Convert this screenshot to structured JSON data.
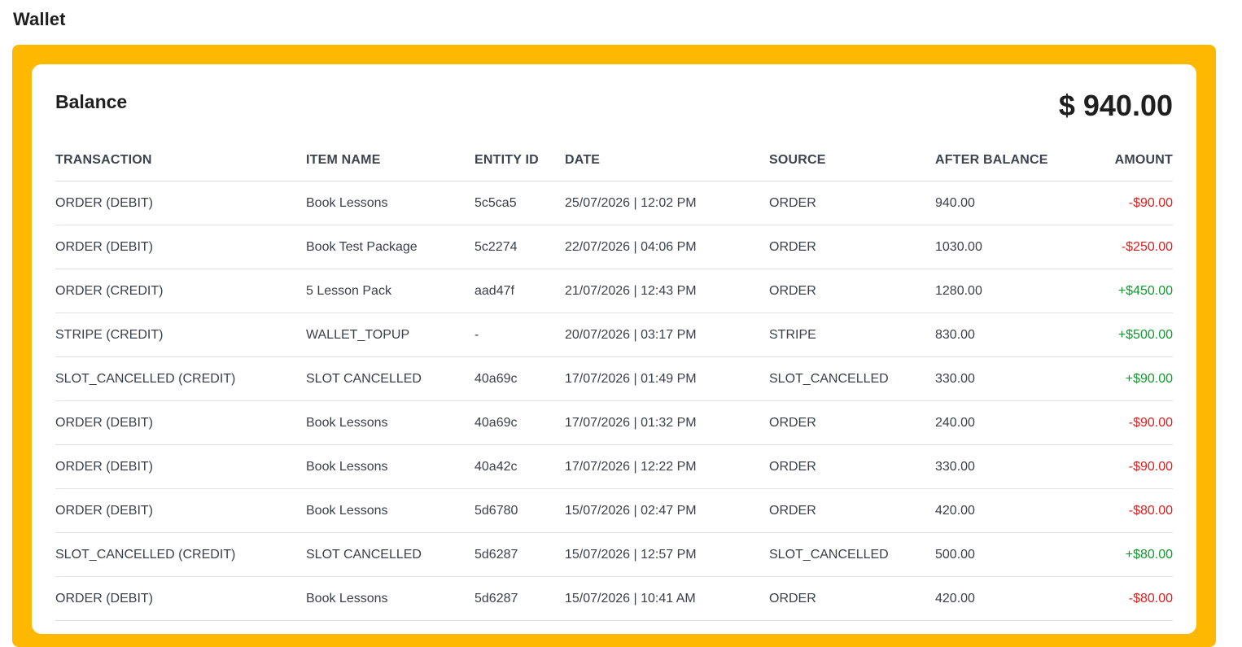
{
  "page": {
    "title": "Wallet"
  },
  "wallet": {
    "balance_label": "Balance",
    "balance_amount": "$ 940.00"
  },
  "colors": {
    "frame": "#ffb800",
    "debit": "#e01e1e",
    "credit": "#12992f"
  },
  "table": {
    "headers": [
      "TRANSACTION",
      "ITEM NAME",
      "ENTITY ID",
      "DATE",
      "SOURCE",
      "AFTER BALANCE",
      "AMOUNT"
    ],
    "rows": [
      {
        "transaction": "ORDER (DEBIT)",
        "item_name": "Book Lessons",
        "entity_id": "5c5ca5",
        "date": "25/07/2026 | 12:02 PM",
        "source": "ORDER",
        "after_balance": "940.00",
        "amount": "-$90.00",
        "type": "debit"
      },
      {
        "transaction": "ORDER (DEBIT)",
        "item_name": "Book Test Package",
        "entity_id": "5c2274",
        "date": "22/07/2026 | 04:06 PM",
        "source": "ORDER",
        "after_balance": "1030.00",
        "amount": "-$250.00",
        "type": "debit"
      },
      {
        "transaction": "ORDER (CREDIT)",
        "item_name": "5 Lesson Pack",
        "entity_id": "aad47f",
        "date": "21/07/2026 | 12:43 PM",
        "source": "ORDER",
        "after_balance": "1280.00",
        "amount": "+$450.00",
        "type": "credit"
      },
      {
        "transaction": "STRIPE (CREDIT)",
        "item_name": "WALLET_TOPUP",
        "entity_id": "-",
        "date": "20/07/2026 | 03:17 PM",
        "source": "STRIPE",
        "after_balance": "830.00",
        "amount": "+$500.00",
        "type": "credit"
      },
      {
        "transaction": "SLOT_CANCELLED (CREDIT)",
        "item_name": "SLOT CANCELLED",
        "entity_id": "40a69c",
        "date": "17/07/2026 | 01:49 PM",
        "source": "SLOT_CANCELLED",
        "after_balance": "330.00",
        "amount": "+$90.00",
        "type": "credit"
      },
      {
        "transaction": "ORDER (DEBIT)",
        "item_name": "Book Lessons",
        "entity_id": "40a69c",
        "date": "17/07/2026 | 01:32 PM",
        "source": "ORDER",
        "after_balance": "240.00",
        "amount": "-$90.00",
        "type": "debit"
      },
      {
        "transaction": "ORDER (DEBIT)",
        "item_name": "Book Lessons",
        "entity_id": "40a42c",
        "date": "17/07/2026 | 12:22 PM",
        "source": "ORDER",
        "after_balance": "330.00",
        "amount": "-$90.00",
        "type": "debit"
      },
      {
        "transaction": "ORDER (DEBIT)",
        "item_name": "Book Lessons",
        "entity_id": "5d6780",
        "date": "15/07/2026 | 02:47 PM",
        "source": "ORDER",
        "after_balance": "420.00",
        "amount": "-$80.00",
        "type": "debit"
      },
      {
        "transaction": "SLOT_CANCELLED (CREDIT)",
        "item_name": "SLOT CANCELLED",
        "entity_id": "5d6287",
        "date": "15/07/2026 | 12:57 PM",
        "source": "SLOT_CANCELLED",
        "after_balance": "500.00",
        "amount": "+$80.00",
        "type": "credit"
      },
      {
        "transaction": "ORDER (DEBIT)",
        "item_name": "Book Lessons",
        "entity_id": "5d6287",
        "date": "15/07/2026 | 10:41 AM",
        "source": "ORDER",
        "after_balance": "420.00",
        "amount": "-$80.00",
        "type": "debit"
      }
    ]
  }
}
